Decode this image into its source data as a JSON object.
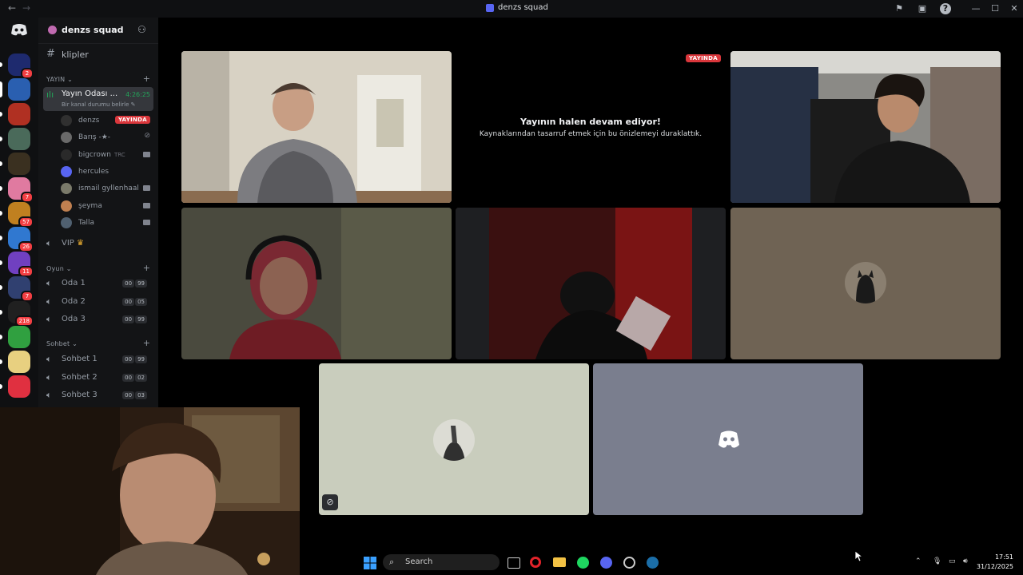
{
  "window": {
    "title": "denzs squad",
    "accent": "#5865f2",
    "live_red": "#da373c"
  },
  "rail": {
    "servers": [
      {
        "name": "tr-server-icon",
        "badge": "2",
        "color": "#1e2a6e"
      },
      {
        "name": "denzs-squad-icon",
        "badge": "",
        "color": "#2a5fb0"
      },
      {
        "name": "gaming-icon",
        "badge": "",
        "color": "#b03022"
      },
      {
        "name": "server-icon-4",
        "badge": "",
        "color": "#4a6a5a"
      },
      {
        "name": "server-icon-5",
        "badge": "",
        "color": "#3a3020"
      },
      {
        "name": "server-icon-6",
        "badge": "7",
        "color": "#e07aa0"
      },
      {
        "name": "server-icon-7",
        "badge": "57",
        "color": "#c08020"
      },
      {
        "name": "server-icon-8",
        "badge": "26",
        "color": "#3078d0"
      },
      {
        "name": "server-icon-9",
        "badge": "11",
        "color": "#7040c0"
      },
      {
        "name": "server-icon-10",
        "badge": "7",
        "color": "#304070"
      },
      {
        "name": "server-icon-11",
        "badge": "218",
        "color": "#202020"
      },
      {
        "name": "frog-icon",
        "badge": "",
        "color": "#30a040"
      },
      {
        "name": "server-icon-13",
        "badge": "",
        "color": "#e8d080"
      },
      {
        "name": "valorant-icon",
        "badge": "",
        "color": "#e03040"
      }
    ]
  },
  "sidebar": {
    "server_name": "denzs squad",
    "text_channel": "klipler",
    "cat_yayin": "YAYIN",
    "active_channel": {
      "name": "Yayın Odası ...",
      "timer": "4:26:25",
      "status": "Bir kanal durumu belirle"
    },
    "members": [
      {
        "name": "denzs",
        "live": "YAYINDA",
        "cam": false,
        "color": "#303030"
      },
      {
        "name": "Barış -★-",
        "live": "",
        "cam": false,
        "color": "#6a6a6a"
      },
      {
        "name": "bigcrown",
        "tag": "TRC",
        "live": "",
        "cam": true,
        "color": "#2a2a2a"
      },
      {
        "name": "hercules",
        "live": "",
        "cam": false,
        "color": "#5865f2"
      },
      {
        "name": "ismail gyllenhaal",
        "live": "",
        "cam": true,
        "color": "#7a7a6a"
      },
      {
        "name": "şeyma",
        "live": "",
        "cam": true,
        "color": "#c08050"
      },
      {
        "name": "Talla",
        "live": "",
        "cam": true,
        "color": "#506070"
      }
    ],
    "vip_channel": "VIP",
    "cat_oyun": "Oyun",
    "oyun_channels": [
      {
        "name": "Oda 1",
        "a": "00",
        "b": "99"
      },
      {
        "name": "Oda 2",
        "a": "00",
        "b": "05"
      },
      {
        "name": "Oda 3",
        "a": "00",
        "b": "99"
      }
    ],
    "cat_sohbet": "Sohbet",
    "sohbet_channels": [
      {
        "name": "Sohbet 1",
        "a": "00",
        "b": "99"
      },
      {
        "name": "Sohbet 2",
        "a": "00",
        "b": "02"
      },
      {
        "name": "Sohbet 3",
        "a": "00",
        "b": "03"
      }
    ]
  },
  "stage": {
    "live_badge": "YAYINDA",
    "notice_title": "Yayının halen devam ediyor!",
    "notice_sub": "Kaynaklarından tasarruf etmek için bu önizlemeyi duraklattık."
  },
  "taskbar": {
    "search_label": "Search",
    "time": "17:51",
    "date": "31/12/2025"
  }
}
